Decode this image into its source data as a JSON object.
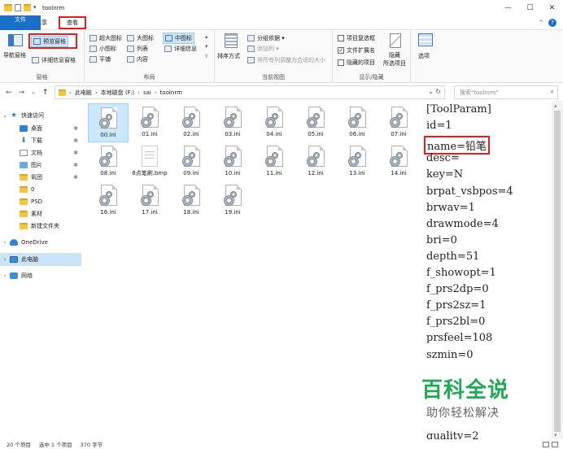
{
  "window": {
    "title": "toolnrm",
    "minimize": "—",
    "maximize": "☐",
    "close": "✕"
  },
  "ribbon_tabs": {
    "file": "文件",
    "home": "主页",
    "share": "共享",
    "view": "查看",
    "collapse": "^",
    "help": "?"
  },
  "ribbon": {
    "panes": {
      "nav_pane": "导航窗格",
      "preview_pane": "预览窗格",
      "details_pane": "详细信息窗格",
      "label": "窗格"
    },
    "layout": {
      "items": [
        "超大图标",
        "大图标",
        "中图标",
        "小图标",
        "列表",
        "详细信息",
        "平铺",
        "内容"
      ],
      "label": "布局"
    },
    "current_view": {
      "sort": "排序方式",
      "group_by": "分组依据 ▾",
      "add_column": "添加列 ▾",
      "fit_columns": "将所有列调整为合适的大小",
      "label": "当前视图"
    },
    "show_hide": {
      "item_checkbox": "项目复选框",
      "file_ext": "文件扩展名",
      "hidden_items": "隐藏的项目",
      "hide_selected": "隐藏",
      "hide_selected_2": "所选项目",
      "label": "显示/隐藏"
    },
    "options": "选项"
  },
  "address": {
    "back": "←",
    "forward": "→",
    "recent": "⌄",
    "up": "↑",
    "crumbs": [
      "此电脑",
      "本地磁盘 (F:)",
      "sai",
      "toolnrm"
    ],
    "dropdown": "⌄",
    "refresh": "↻",
    "search_placeholder": "搜索\"toolnrm\"",
    "search_icon": "⌕"
  },
  "nav": {
    "quick_access": "快速访问",
    "items": [
      {
        "label": "桌面",
        "icon": "desktop-icon"
      },
      {
        "label": "下载",
        "icon": "download-icon"
      },
      {
        "label": "文档",
        "icon": "document-icon"
      },
      {
        "label": "图片",
        "icon": "picture-icon"
      },
      {
        "label": "氧团",
        "icon": "folder-icon"
      },
      {
        "label": "0",
        "icon": "folder-icon"
      },
      {
        "label": "PSD",
        "icon": "folder-icon"
      },
      {
        "label": "素材",
        "icon": "folder-icon"
      },
      {
        "label": "新建文件夹",
        "icon": "folder-icon"
      }
    ],
    "onedrive": "OneDrive",
    "this_pc": "此电脑",
    "network": "网络"
  },
  "files": [
    {
      "name": "00.ini",
      "selected": true
    },
    {
      "name": "01.ini"
    },
    {
      "name": "02.ini"
    },
    {
      "name": "03.ini"
    },
    {
      "name": "04.ini"
    },
    {
      "name": "05.ini"
    },
    {
      "name": "06.ini"
    },
    {
      "name": "07.ini"
    },
    {
      "name": "08.ini"
    },
    {
      "name": "8点笔刷.bmp",
      "plain": true
    },
    {
      "name": "09.ini"
    },
    {
      "name": "10.ini"
    },
    {
      "name": "11.ini"
    },
    {
      "name": "12.ini"
    },
    {
      "name": "13.ini"
    },
    {
      "name": "14.ini"
    },
    {
      "name": "16.ini"
    },
    {
      "name": "17.ini"
    },
    {
      "name": "18.ini"
    },
    {
      "name": "19.ini"
    }
  ],
  "preview_lines": [
    "[ToolParam]",
    "id=1",
    "name=铅笔",
    "desc=",
    "key=N",
    "brpat_vsbpos=4",
    "brwav=1",
    "drawmode=4",
    "bri=0",
    "depth=51",
    "f_showopt=1",
    "f_prs2dp=0",
    "f_prs2sz=1",
    "f_prs2bl=0",
    "prsfeel=108",
    "szmin=0",
    "",
    "",
    "",
    "",
    "quality=2"
  ],
  "watermark": {
    "title": "百科全说",
    "subtitle": "助你轻松解决"
  },
  "status": {
    "count": "20 个项目",
    "selected": "选中 1 个项目",
    "size": "370 字节"
  },
  "colors": {
    "accent": "#1a6fc9",
    "highlight_box": "#e02020",
    "watermark_green": "#1faa53"
  }
}
